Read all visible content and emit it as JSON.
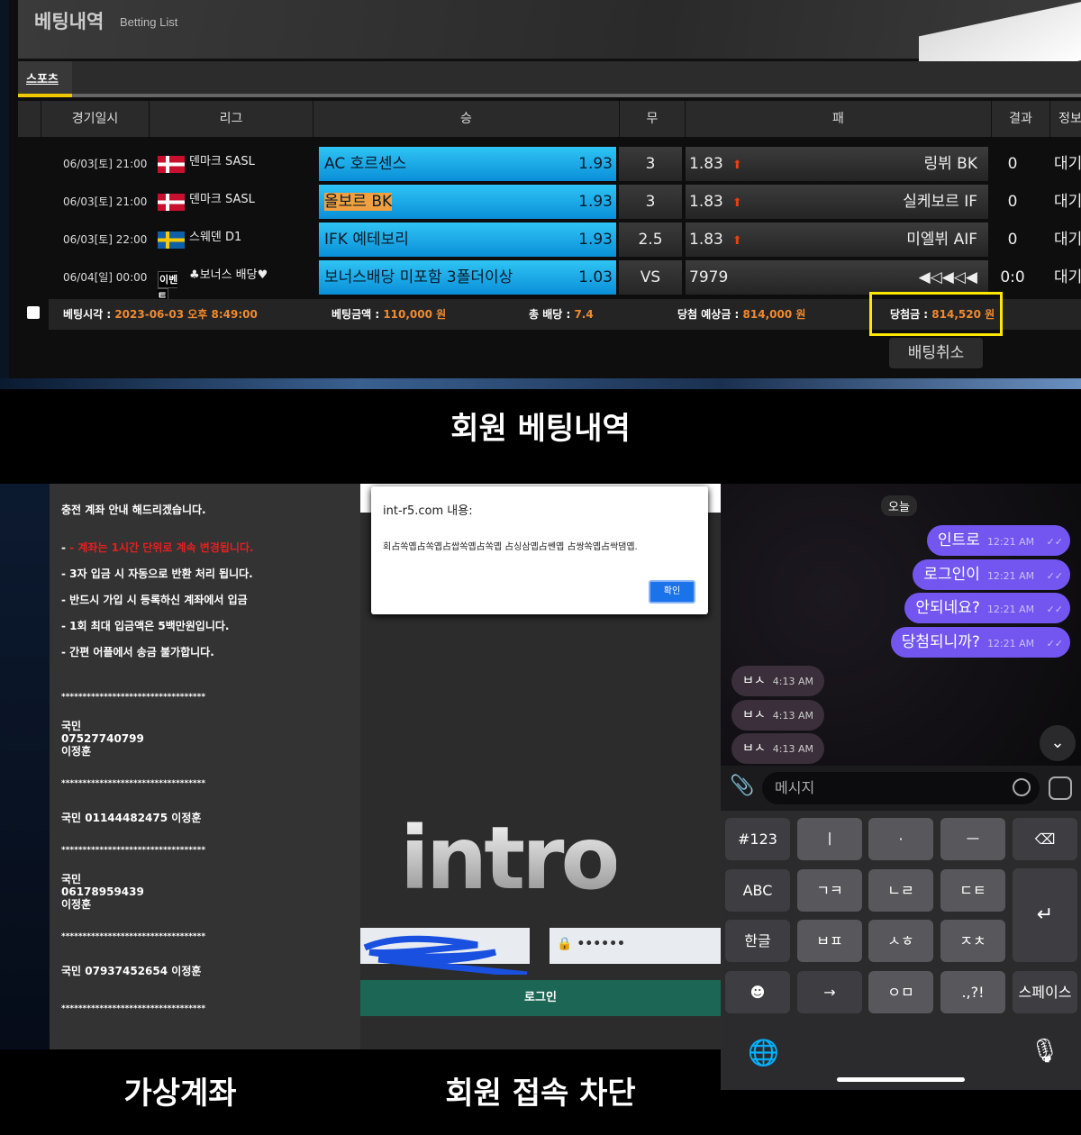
{
  "betting": {
    "title": "베팅내역",
    "subtitle": "Betting List",
    "tab": "스포츠",
    "headers": [
      "경기일시",
      "리그",
      "승",
      "무",
      "패",
      "결과",
      "정보"
    ],
    "rows": [
      {
        "date": "06/03[토] 21:00",
        "flag": "denmark",
        "league": "덴마크 SASL",
        "home": "AC 호르센스",
        "home_odds": "1.93",
        "draw": "3",
        "away_odds": "1.83",
        "away": "링뷔 BK",
        "result": "0",
        "status": "대기",
        "selected": false
      },
      {
        "date": "06/03[토] 21:00",
        "flag": "denmark",
        "league": "덴마크 SASL",
        "home": "올보르 BK",
        "home_odds": "1.93",
        "draw": "3",
        "away_odds": "1.83",
        "away": "실케보르 IF",
        "result": "0",
        "status": "대기",
        "selected": true
      },
      {
        "date": "06/03[토] 22:00",
        "flag": "sweden",
        "league": "스웨덴 D1",
        "home": "IFK 예테보리",
        "home_odds": "1.93",
        "draw": "2.5",
        "away_odds": "1.83",
        "away": "미엘뷔 AIF",
        "result": "0",
        "status": "대기",
        "selected": false
      },
      {
        "date": "06/04[일] 00:00",
        "flag": "event",
        "league": "♣보너스 배당♥",
        "event_badge": "이벤트",
        "home": "보너스배당 미포함 3폴더이상",
        "home_odds": "1.03",
        "draw": "VS",
        "away_odds": "7979",
        "away": "◀◁◀◁◀",
        "result": "0:0",
        "status": "대기",
        "selected": false
      }
    ],
    "summary": {
      "time_label": "베팅시각 : ",
      "time": "2023-06-03 오후 8:49:00",
      "amount_label": "베팅금액 : ",
      "amount": "110,000 원",
      "odds_label": "총 배당 : ",
      "odds": "7.4",
      "expected_label": "당첨 예상금 : ",
      "expected": "814,000 원",
      "win_label": "당첨금 : ",
      "win": "814,520 원"
    },
    "cancel": "배팅취소",
    "highlight_color": "#ffe800"
  },
  "captions": {
    "betting": "회원 베팅내역",
    "account": "가상계좌",
    "block": "회원 접속 차단"
  },
  "account": {
    "intro": "충전 계좌 안내 해드리겠습니다.",
    "notice_red": "- 계좌는 1시간 단위로 계속 변경됩니다.",
    "rules": [
      "- 3자 입금 시 자동으로 반환 처리 됩니다.",
      "- 반드시 가입 시 등록하신 계좌에서 입금",
      "- 1회 최대 입금액은 5백만원입니다.",
      "- 간편 어플에서 송금 불가합니다."
    ],
    "sep": "**********************************",
    "entries": [
      [
        "국민",
        "07527740799",
        "이정훈"
      ],
      [
        "국민 01144482475 이정훈"
      ],
      [
        "국민",
        "06178959439",
        "이정훈"
      ],
      [
        "국민 07937452654 이정훈"
      ]
    ]
  },
  "dialog": {
    "title": "int-r5.com 내용:",
    "message": "회占쏙옙占쏙옙占쌉쏙옙占쏙옙 占싱삼옙占쎈옙 占쌍쏙옙占싹댐옙.",
    "ok": "확인"
  },
  "site": {
    "logo": "intro",
    "password": "••••••",
    "login": "로그인"
  },
  "chat": {
    "date": "오늘",
    "sent": [
      {
        "text": "인트로",
        "time": "12:21 AM"
      },
      {
        "text": "로그인이",
        "time": "12:21 AM"
      },
      {
        "text": "안되네요?",
        "time": "12:21 AM"
      },
      {
        "text": "당첨되니까?",
        "time": "12:21 AM"
      }
    ],
    "received": [
      {
        "text": "ㅂㅅ",
        "time": "4:13 AM"
      },
      {
        "text": "ㅂㅅ",
        "time": "4:13 AM"
      },
      {
        "text": "ㅂㅅ",
        "time": "4:13 AM"
      }
    ],
    "placeholder": "메시지",
    "bubble_color": "#7356f0"
  },
  "keyboard": {
    "rows": [
      [
        "#123",
        "ㅣ",
        "·",
        "ㅡ",
        "⌫"
      ],
      [
        "ABC",
        "ㄱㅋ",
        "ㄴㄹ",
        "ㄷㅌ"
      ],
      [
        "한글",
        "ㅂㅍ",
        "ㅅㅎ",
        "ㅈㅊ"
      ],
      [
        "☻",
        "→",
        "ㅇㅁ",
        ".,?!",
        "스페이스"
      ]
    ],
    "enter": "↵"
  }
}
